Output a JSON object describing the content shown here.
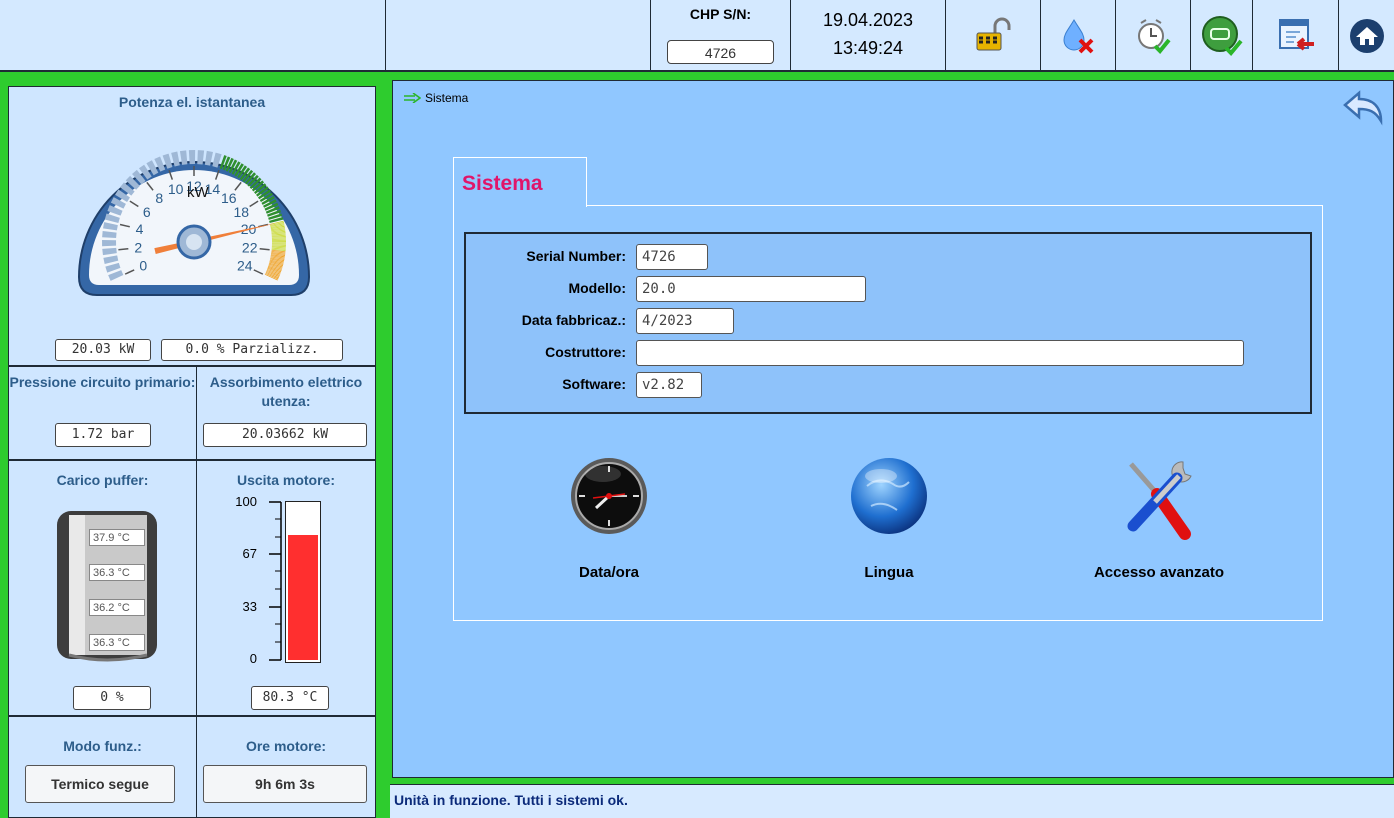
{
  "header": {
    "chp_label": "CHP S/N:",
    "chp_value": "4726",
    "date": "19.04.2023",
    "time": "13:49:24",
    "icons": [
      "unlock-icon",
      "gas-error-icon",
      "timer-ok-icon",
      "engine-ok-icon",
      "exit-window-icon",
      "home-icon"
    ]
  },
  "left": {
    "power_title": "Potenza el. istantanea",
    "gauge": {
      "unit": "kW",
      "ticks": [
        "0",
        "2",
        "4",
        "6",
        "8",
        "10",
        "12",
        "14",
        "16",
        "18",
        "20",
        "22",
        "24"
      ],
      "min": 0,
      "max": 24,
      "value": 20.03
    },
    "power_value": "20.03 kW",
    "partial_value": "0.0 % Parzializz.",
    "pressure_title": "Pressione circuito primario:",
    "pressure_value": "1.72 bar",
    "absorption_title": "Assorbimento elettrico utenza:",
    "absorption_value": "20.03662 kW",
    "buffer_title": "Carico puffer:",
    "buffer_temps": [
      "37.9 °C",
      "36.3 °C",
      "36.2 °C",
      "36.3 °C"
    ],
    "buffer_value": "0 %",
    "engine_title": "Uscita motore:",
    "engine_ticks": [
      "100",
      "67",
      "33",
      "0"
    ],
    "engine_level_percent": 80.3,
    "engine_value": "80.3 °C",
    "mode_title": "Modo funz.:",
    "mode_value": "Termico segue",
    "hours_title": "Ore motore:",
    "hours_value": "9h 6m 3s"
  },
  "main": {
    "breadcrumb": "Sistema",
    "tab_title": "Sistema",
    "fields": [
      {
        "label": "Serial Number:",
        "value": "4726"
      },
      {
        "label": "Modello:",
        "value": "20.0"
      },
      {
        "label": "Data fabbricaz.:",
        "value": "4/2023"
      },
      {
        "label": "Costruttore:",
        "value": ""
      },
      {
        "label": "Software:",
        "value": "v2.82"
      }
    ],
    "menu": [
      {
        "label": "Data/ora",
        "icon": "clock-icon"
      },
      {
        "label": "Lingua",
        "icon": "globe-icon"
      },
      {
        "label": "Accesso avanzato",
        "icon": "tools-icon"
      }
    ]
  },
  "status_text": "Unità in funzione. Tutti i sistemi ok.",
  "colors": {
    "accent_green": "#2ecc2e",
    "tab_title": "#e0156a",
    "title_blue": "#2d5d8a",
    "status_text": "#0b2a7a"
  }
}
